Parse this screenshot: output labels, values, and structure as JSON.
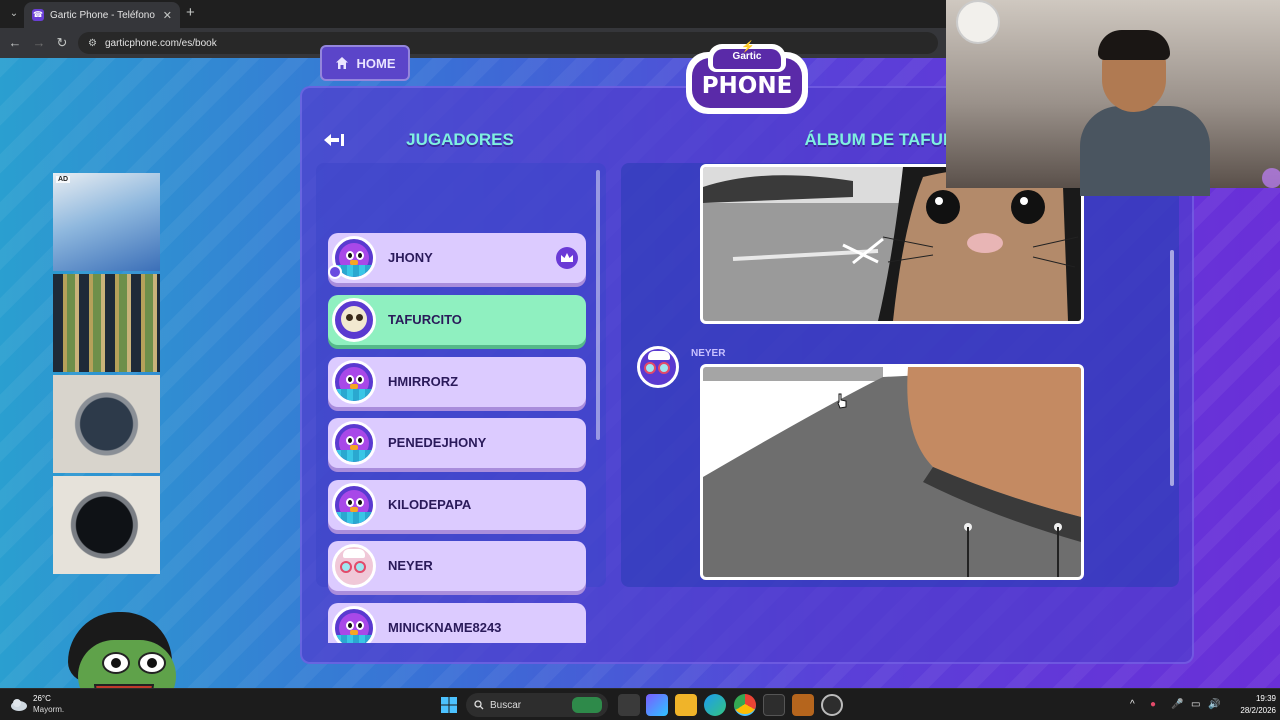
{
  "browser": {
    "tab_title": "Gartic Phone - Teléfono Descon",
    "url": "garticphone.com/es/book",
    "tab_close": "✕",
    "new_tab": "+",
    "back": "←",
    "forward": "→",
    "reload": "↻",
    "tab_list": "⌄"
  },
  "game": {
    "home_label": "HOME",
    "logo_small": "Gartic",
    "logo_big": "PHONE",
    "players_title": "JUGADORES",
    "album_title": "ÁLBUM DE TAFURCITO",
    "players": [
      {
        "name": "JHONY",
        "avatar": "bird",
        "host": true,
        "active": false
      },
      {
        "name": "TAFURCITO",
        "avatar": "skull",
        "host": false,
        "active": true
      },
      {
        "name": "HMIRRORZ",
        "avatar": "bird",
        "host": false,
        "active": false
      },
      {
        "name": "PENEDEJHONY",
        "avatar": "bird",
        "host": false,
        "active": false
      },
      {
        "name": "KILODEPAPA",
        "avatar": "bird",
        "host": false,
        "active": false
      },
      {
        "name": "NEYER",
        "avatar": "goggles",
        "host": false,
        "active": false
      },
      {
        "name": "MINICKNAME8243",
        "avatar": "bird",
        "host": false,
        "active": false
      }
    ],
    "album_author": "NEYER",
    "ad_tag": "AD"
  },
  "taskbar": {
    "weather_temp": "26°C",
    "weather_desc": "Mayorm.",
    "search_placeholder": "Buscar",
    "time": "19:39",
    "date": "28/2/2026"
  },
  "colors": {
    "accent_title": "#7ff0e0",
    "active_player": "#8ff0c0",
    "player_card": "#dccbff",
    "panel": "#503ccd"
  }
}
